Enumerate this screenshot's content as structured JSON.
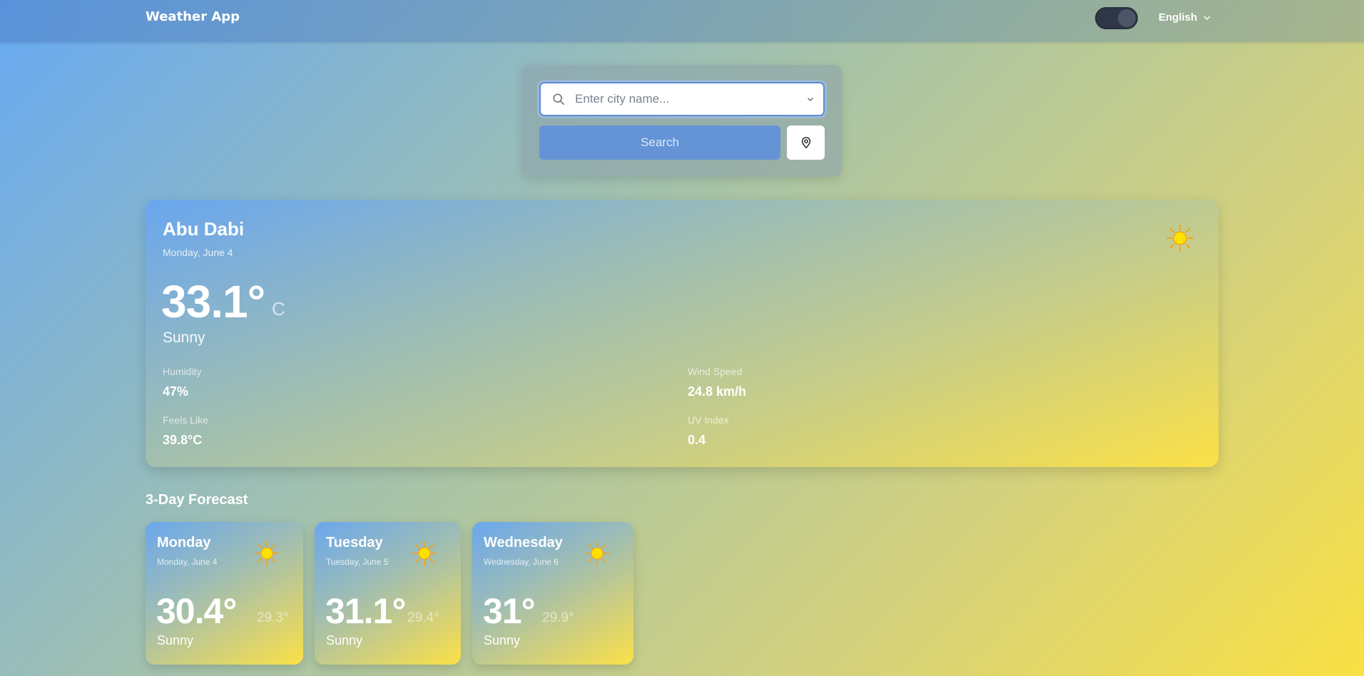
{
  "app": {
    "title": "Weather App"
  },
  "header": {
    "language": "English",
    "theme_toggle": "dark-mode"
  },
  "search": {
    "placeholder": "Enter city name...",
    "button_label": "Search"
  },
  "current": {
    "city": "Abu Dabi",
    "date": "Monday, June 4",
    "temperature": "33.1°",
    "unit": "C",
    "condition": "Sunny",
    "icon": "sun-icon",
    "stats": {
      "humidity_label": "Humidity",
      "humidity": "47%",
      "wind_label": "Wind Speed",
      "wind": "24.8 km/h",
      "feels_label": "Feels Like",
      "feels": "39.8°C",
      "uv_label": "UV Index",
      "uv": "0.4"
    }
  },
  "forecast": {
    "title": "3-Day Forecast",
    "days": [
      {
        "day": "Monday",
        "date": "Monday, June 4",
        "high": "30.4°",
        "low": "29.3°",
        "condition": "Sunny",
        "icon": "sun-icon"
      },
      {
        "day": "Tuesday",
        "date": "Tuesday, June 5",
        "high": "31.1°",
        "low": "29.4°",
        "condition": "Sunny",
        "icon": "sun-icon"
      },
      {
        "day": "Wednesday",
        "date": "Wednesday, June 6",
        "high": "31°",
        "low": "29.9°",
        "condition": "Sunny",
        "icon": "sun-icon"
      }
    ]
  },
  "colors": {
    "accent": "#6494d6",
    "sun": "#f5c400",
    "sun_rays": "#f2a31a"
  }
}
